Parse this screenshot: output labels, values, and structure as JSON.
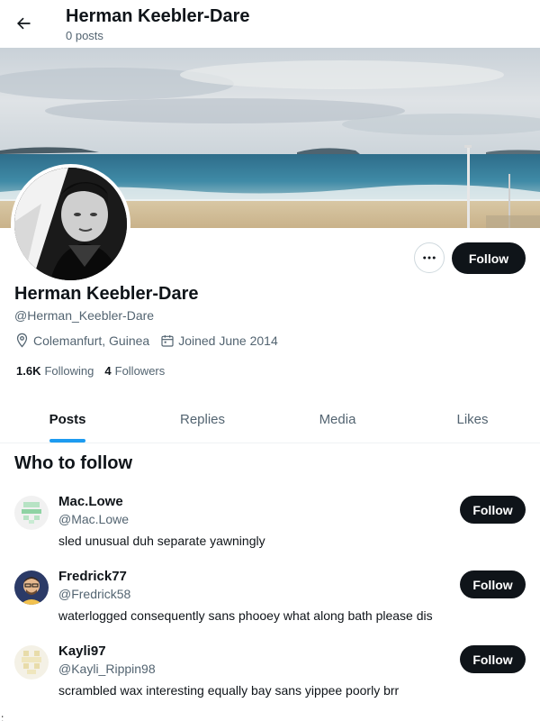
{
  "header": {
    "title": "Herman Keebler-Dare",
    "subtitle": "0 posts"
  },
  "profile": {
    "name": "Herman Keebler-Dare",
    "handle": "@Herman_Keebler-Dare",
    "location": "Colemanfurt, Guinea",
    "joined": "Joined June 2014",
    "following_count": "1.6K",
    "following_label": "Following",
    "followers_count": "4",
    "followers_label": "Followers",
    "follow_label": "Follow",
    "more_icon": "ellipsis-icon"
  },
  "tabs": [
    {
      "label": "Posts",
      "active": true
    },
    {
      "label": "Replies",
      "active": false
    },
    {
      "label": "Media",
      "active": false
    },
    {
      "label": "Likes",
      "active": false
    }
  ],
  "who_to_follow": {
    "title": "Who to follow",
    "users": [
      {
        "name": "Mac.Lowe",
        "handle": "@Mac.Lowe",
        "bio": "sled unusual duh separate yawningly",
        "follow_label": "Follow"
      },
      {
        "name": "Fredrick77",
        "handle": "@Fredrick58",
        "bio": "waterlogged consequently sans phooey what along bath please dis",
        "follow_label": "Follow"
      },
      {
        "name": "Kayli97",
        "handle": "@Kayli_Rippin98",
        "bio": "scrambled wax interesting equally bay sans yippee poorly brr",
        "follow_label": "Follow"
      }
    ]
  },
  "stray_text": ":",
  "colors": {
    "accent": "#1d9bf0",
    "button_dark": "#0f1419",
    "muted": "#536471"
  }
}
